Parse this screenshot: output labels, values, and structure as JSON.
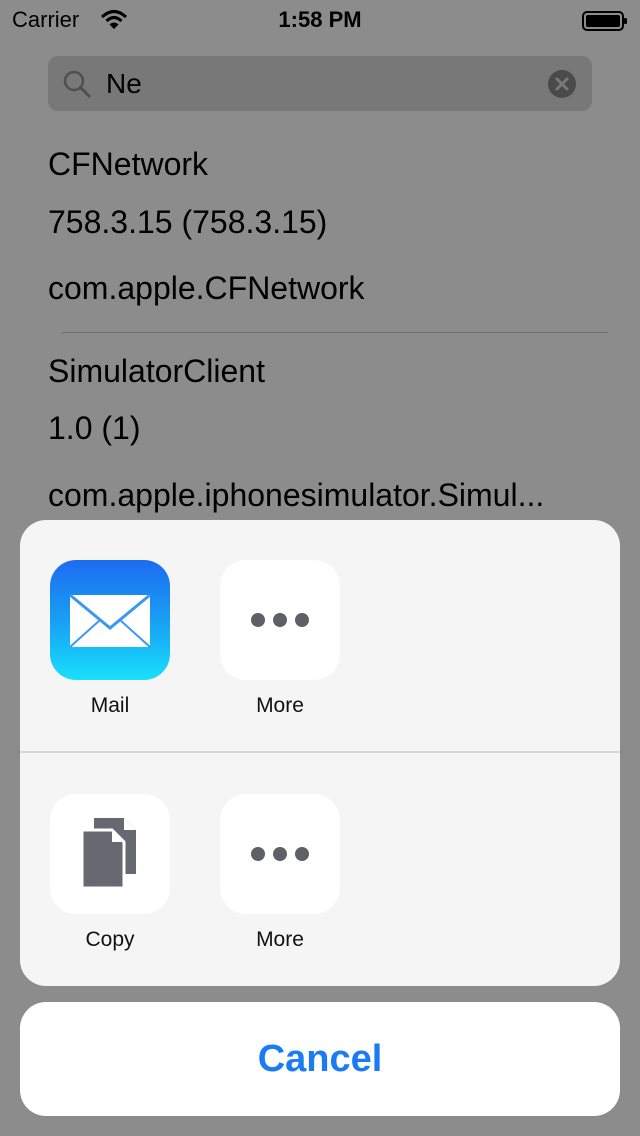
{
  "status_bar": {
    "carrier": "Carrier",
    "time": "1:58 PM"
  },
  "search": {
    "query": "Ne"
  },
  "results": [
    {
      "name": "CFNetwork",
      "version": "758.3.15 (758.3.15)",
      "bundle_id": "com.apple.CFNetwork"
    },
    {
      "name": "SimulatorClient",
      "version": "1.0 (1)",
      "bundle_id": "com.apple.iphonesimulator.Simul..."
    }
  ],
  "share_sheet": {
    "share_row": [
      {
        "label": "Mail",
        "icon": "mail-icon"
      },
      {
        "label": "More",
        "icon": "more-icon"
      }
    ],
    "action_row": [
      {
        "label": "Copy",
        "icon": "copy-icon"
      },
      {
        "label": "More",
        "icon": "more-icon"
      }
    ],
    "cancel_label": "Cancel"
  },
  "colors": {
    "accent": "#1a7cf5",
    "dimmed_background": "#8c8c8c",
    "sheet_background": "#f5f5f5"
  }
}
